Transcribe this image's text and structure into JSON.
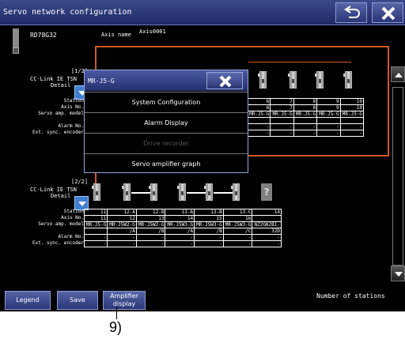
{
  "window": {
    "title": "Servo network configuration"
  },
  "controller": {
    "model": "RD78G32",
    "axis_name_label": "Axis name",
    "axis_name_value": "Axis0001"
  },
  "row_labels": [
    "Station",
    "Axis No.",
    "Servo amp. model",
    "Alarm No.",
    "Ext. sync. encoder"
  ],
  "network1": {
    "page": "[1/2]",
    "name": "CC-Link IE TSN",
    "detail": "Detail",
    "columns": [
      {
        "station": "6",
        "axis": "6",
        "model": "MR-J5-G",
        "alarm": "-",
        "enc": "-"
      },
      {
        "station": "7",
        "axis": "7",
        "model": "MR-J5-G",
        "alarm": "-",
        "enc": "-"
      },
      {
        "station": "8",
        "axis": "8",
        "model": "MR-J5-G",
        "alarm": "-",
        "enc": "-"
      },
      {
        "station": "9",
        "axis": "9",
        "model": "MR-J5-G",
        "alarm": "-",
        "enc": "-"
      },
      {
        "station": "10",
        "axis": "10",
        "model": "MR-J5-G",
        "alarm": "-",
        "enc": "-"
      }
    ]
  },
  "network2": {
    "page": "[2/2]",
    "name": "CC-Link IE TSN",
    "detail": "Detail",
    "columns": [
      {
        "station": "11",
        "axis": "11",
        "model": "MR-J5-G",
        "model2": "",
        "alarm": "-",
        "enc": "-"
      },
      {
        "station": "12-A",
        "axis": "12",
        "model": "MR-J5W2-G",
        "model2": "/A",
        "alarm": "-",
        "enc": "-"
      },
      {
        "station": "12-B",
        "axis": "13",
        "model": "MR-J5W2-G",
        "model2": "/B",
        "alarm": "-",
        "enc": "-"
      },
      {
        "station": "13-A",
        "axis": "14",
        "model": "MR-J5W3-G",
        "model2": "/A",
        "alarm": "-",
        "enc": "-"
      },
      {
        "station": "13-B",
        "axis": "15",
        "model": "MR-J5W3-G",
        "model2": "/B",
        "alarm": "-",
        "enc": "-"
      },
      {
        "station": "13-C",
        "axis": "16",
        "model": "MR-J5W3-G",
        "model2": "/C",
        "alarm": "-",
        "enc": "-"
      },
      {
        "station": "14",
        "axis": "",
        "model": "NZ2GN2B1-",
        "model2": "32D",
        "alarm": "-",
        "enc": "-"
      }
    ]
  },
  "popup": {
    "title": "MR-J5-G",
    "items": [
      "System Configuration",
      "Alarm Display",
      "Drive recorder",
      "Servo amplifier graph"
    ]
  },
  "bottom": {
    "legend": "Legend",
    "save": "Save",
    "amp_display_line1": "Amplifier",
    "amp_display_line2": "display",
    "stations_label": "Number of stations"
  },
  "callout": "9)"
}
